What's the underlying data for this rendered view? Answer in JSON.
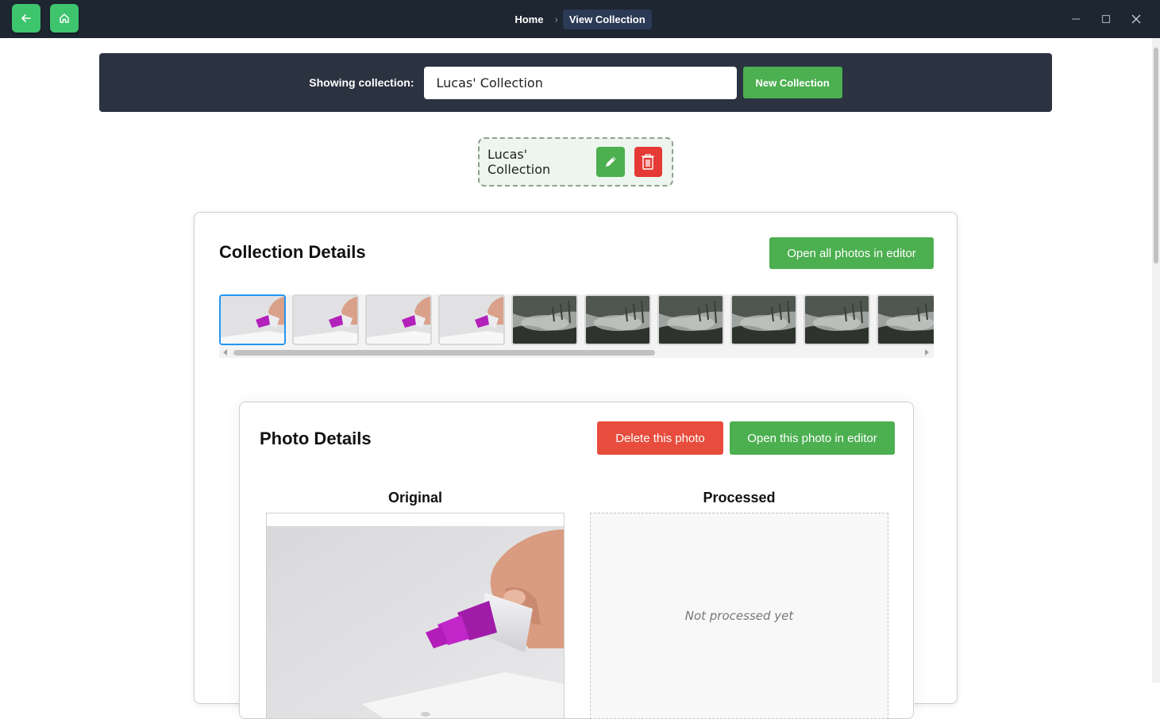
{
  "titlebar": {
    "breadcrumbs": [
      "Home",
      "View Collection"
    ],
    "back_icon": "arrow-left-icon",
    "home_icon": "home-icon",
    "accent": "#3ec46d"
  },
  "collection_bar": {
    "label": "Showing collection:",
    "selected": "Lucas' Collection",
    "new_button": "New Collection"
  },
  "collection_tag": {
    "name": "Lucas' Collection",
    "edit_icon": "pencil-icon",
    "delete_icon": "trash-icon"
  },
  "details": {
    "title": "Collection Details",
    "open_all": "Open all photos in editor",
    "thumbnails": [
      {
        "kind": "test-kit",
        "selected": true
      },
      {
        "kind": "test-kit",
        "selected": false
      },
      {
        "kind": "test-kit",
        "selected": false
      },
      {
        "kind": "test-kit",
        "selected": false
      },
      {
        "kind": "forest",
        "selected": false
      },
      {
        "kind": "forest",
        "selected": false
      },
      {
        "kind": "forest",
        "selected": false
      },
      {
        "kind": "forest",
        "selected": false
      },
      {
        "kind": "forest",
        "selected": false
      },
      {
        "kind": "forest",
        "selected": false
      }
    ]
  },
  "photo": {
    "title": "Photo Details",
    "delete": "Delete this photo",
    "open": "Open this photo in editor",
    "original_label": "Original",
    "processed_label": "Processed",
    "processed_placeholder": "Not processed yet"
  }
}
